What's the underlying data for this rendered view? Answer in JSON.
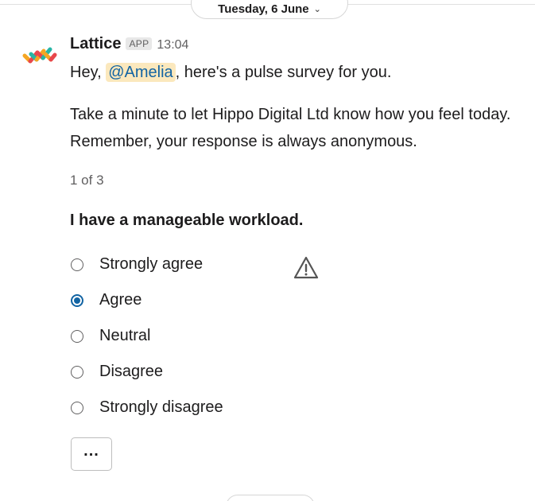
{
  "divider": {
    "date_label": "Tuesday, 6 June"
  },
  "message": {
    "sender": "Lattice",
    "badge": "APP",
    "time": "13:04",
    "greeting_prefix": "Hey, ",
    "mention": "@Amelia",
    "greeting_suffix": ", here's a pulse survey for you.",
    "paragraph": "Take a minute to let Hippo Digital Ltd know how you feel today. Remember, your response is always anonymous.",
    "counter": "1 of 3",
    "question": "I have a manageable workload.",
    "options": [
      {
        "label": "Strongly agree",
        "selected": false
      },
      {
        "label": "Agree",
        "selected": true
      },
      {
        "label": "Neutral",
        "selected": false
      },
      {
        "label": "Disagree",
        "selected": false
      },
      {
        "label": "Strongly disagree",
        "selected": false
      }
    ],
    "more_button": "..."
  },
  "icons": {
    "avatar": "lattice-logo",
    "warning": "warning-triangle-icon",
    "date_chevron": "chevron-down-icon"
  },
  "colors": {
    "accent": "#1264a3",
    "mention_bg": "#fbe8bd"
  }
}
